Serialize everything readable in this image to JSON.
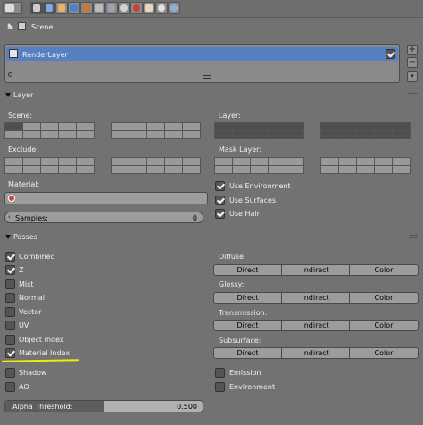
{
  "scene": {
    "label": "Scene"
  },
  "render_layers": {
    "items": [
      {
        "name": "RenderLayer",
        "enabled": true
      }
    ]
  },
  "layer_panel": {
    "title": "Layer",
    "scene_label": "Scene:",
    "layer_label": "Layer:",
    "exclude_label": "Exclude:",
    "mask_layer_label": "Mask Layer:",
    "material_label": "Material:",
    "material_value": "",
    "samples_label": "Samples:",
    "samples_value": "0",
    "checks": [
      {
        "label": "Use Environment",
        "checked": true
      },
      {
        "label": "Use Surfaces",
        "checked": true
      },
      {
        "label": "Use Hair",
        "checked": true
      }
    ]
  },
  "passes_panel": {
    "title": "Passes",
    "passes": [
      {
        "label": "Combined",
        "checked": true
      },
      {
        "label": "Z",
        "checked": true
      },
      {
        "label": "Mist",
        "checked": false
      },
      {
        "label": "Normal",
        "checked": false
      },
      {
        "label": "Vector",
        "checked": false
      },
      {
        "label": "UV",
        "checked": false
      },
      {
        "label": "Object Index",
        "checked": false
      },
      {
        "label": "Material Index",
        "checked": true
      },
      {
        "label": "Shadow",
        "checked": false
      },
      {
        "label": "AO",
        "checked": false
      }
    ],
    "groups": [
      {
        "label": "Diffuse:",
        "buttons": [
          "Direct",
          "Indirect",
          "Color"
        ]
      },
      {
        "label": "Glossy:",
        "buttons": [
          "Direct",
          "Indirect",
          "Color"
        ]
      },
      {
        "label": "Transmission:",
        "buttons": [
          "Direct",
          "Indirect",
          "Color"
        ]
      },
      {
        "label": "Subsurface:",
        "buttons": [
          "Direct",
          "Indirect",
          "Color"
        ]
      }
    ],
    "right_checks": [
      {
        "label": "Emission",
        "checked": false
      },
      {
        "label": "Environment",
        "checked": false
      }
    ],
    "alpha_threshold_label": "Alpha Threshold:",
    "alpha_threshold_value": "0.500",
    "alpha_threshold_fraction": 0.5
  },
  "colors": {
    "selection": "#5680c2",
    "highlight_underline": "#e8f000"
  }
}
